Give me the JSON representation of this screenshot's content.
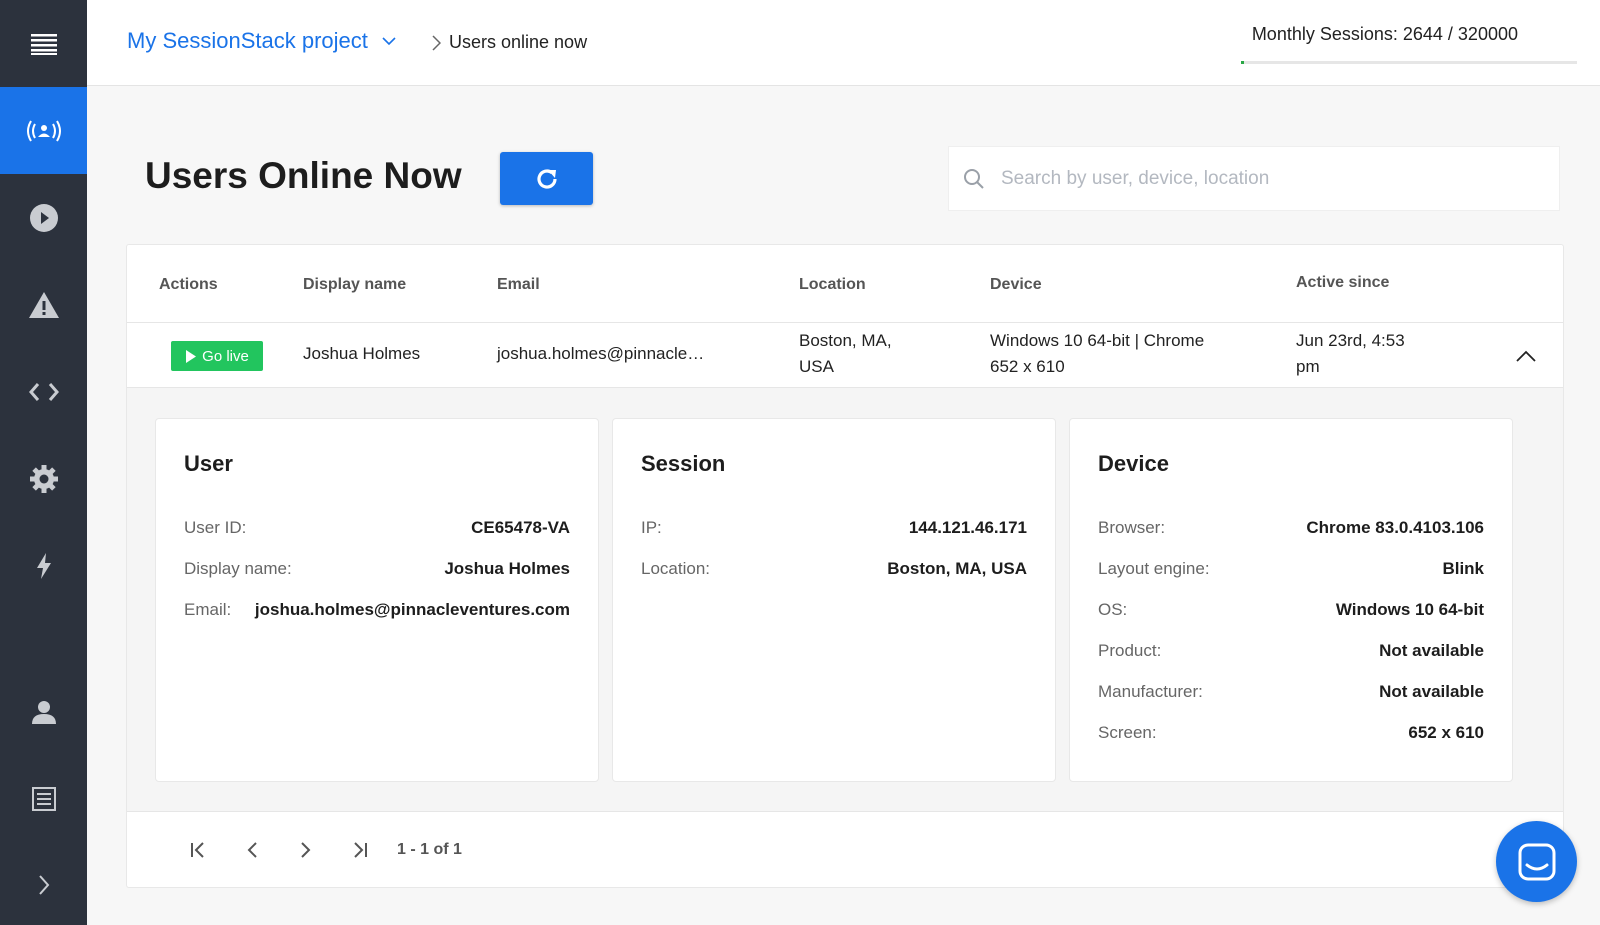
{
  "sidebar": {
    "items": [
      {
        "icon": "menu-icon"
      },
      {
        "icon": "live-users-icon",
        "active": true
      },
      {
        "icon": "play-icon"
      },
      {
        "icon": "warning-icon"
      },
      {
        "icon": "code-icon"
      },
      {
        "icon": "gear-icon"
      },
      {
        "icon": "lightning-icon"
      },
      {
        "icon": "user-icon"
      },
      {
        "icon": "document-icon"
      },
      {
        "icon": "chevron-right-icon"
      }
    ]
  },
  "header": {
    "project": "My SessionStack project",
    "breadcrumb": "Users online now",
    "monthly_label": "Monthly Sessions: 2644 / 320000",
    "quota_used_fraction": 0.008
  },
  "page": {
    "title": "Users Online Now",
    "search_placeholder": "Search by user, device, location"
  },
  "table": {
    "headers": {
      "actions": "Actions",
      "display_name": "Display name",
      "email": "Email",
      "location": "Location",
      "device": "Device",
      "active_since": "Active since"
    },
    "row": {
      "action_label": "Go live",
      "display_name": "Joshua Holmes",
      "email": "joshua.holmes@pinnacle…",
      "location_line1": "Boston, MA,",
      "location_line2": "USA",
      "device_line1": "Windows 10 64-bit | Chrome",
      "device_line2": "652 x 610",
      "active_line1": "Jun 23rd, 4:53",
      "active_line2": "pm"
    }
  },
  "details": {
    "user": {
      "title": "User",
      "rows": [
        {
          "label": "User ID:",
          "value": "CE65478-VA"
        },
        {
          "label": "Display name:",
          "value": "Joshua Holmes"
        },
        {
          "label": "Email:",
          "value": "joshua.holmes@pinnacleventures.com"
        }
      ]
    },
    "session": {
      "title": "Session",
      "rows": [
        {
          "label": "IP:",
          "value": "144.121.46.171"
        },
        {
          "label": "Location:",
          "value": "Boston, MA, USA"
        }
      ]
    },
    "device": {
      "title": "Device",
      "rows": [
        {
          "label": "Browser:",
          "value": "Chrome 83.0.4103.106"
        },
        {
          "label": "Layout engine:",
          "value": "Blink"
        },
        {
          "label": "OS:",
          "value": "Windows 10 64-bit"
        },
        {
          "label": "Product:",
          "value": "Not available"
        },
        {
          "label": "Manufacturer:",
          "value": "Not available"
        },
        {
          "label": "Screen:",
          "value": "652 x 610"
        }
      ]
    }
  },
  "pager": {
    "range": "1 - 1 of 1"
  },
  "colors": {
    "accent": "#1a73e8",
    "sidebar": "#2c323d",
    "go_live": "#22c55e"
  }
}
